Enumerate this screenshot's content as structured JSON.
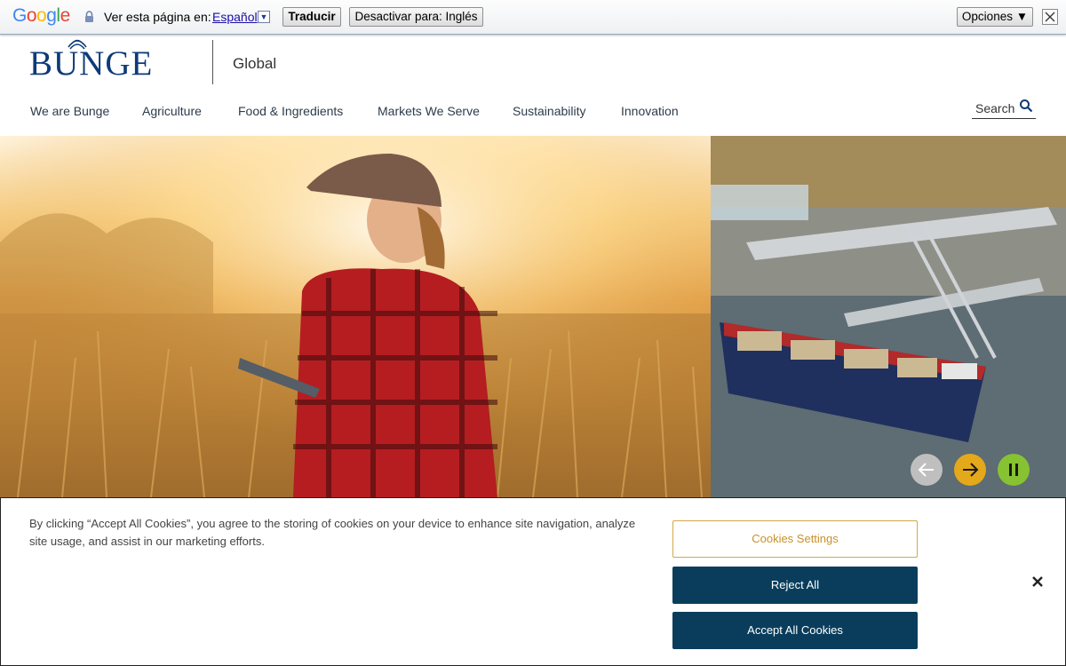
{
  "translate_bar": {
    "logo_letters": [
      {
        "char": "G",
        "color": "#4285f4"
      },
      {
        "char": "o",
        "color": "#ea4335"
      },
      {
        "char": "o",
        "color": "#fbbc05"
      },
      {
        "char": "g",
        "color": "#4285f4"
      },
      {
        "char": "l",
        "color": "#34a853"
      },
      {
        "char": "e",
        "color": "#ea4335"
      }
    ],
    "prompt": "Ver esta página en:",
    "language": "Español",
    "translate_button": "Traducir",
    "disable_button": "Desactivar para: Inglés",
    "options_button": "Opciones ▼"
  },
  "header": {
    "logo_text": "BUNGE",
    "region": "Global",
    "nav": [
      "We are Bunge",
      "Agriculture",
      "Food & Ingredients",
      "Markets We Serve",
      "Sustainability",
      "Innovation"
    ],
    "search_label": "Search"
  },
  "carousel": {
    "controls": [
      "previous",
      "next",
      "pause"
    ]
  },
  "cookie_banner": {
    "text": "By clicking “Accept All Cookies”, you agree to the storing of cookies on your device to enhance site navigation, analyze site usage, and assist in our marketing efforts.",
    "settings_button": "Cookies Settings",
    "reject_button": "Reject All",
    "accept_button": "Accept All Cookies"
  },
  "colors": {
    "brand_navy": "#0e3a78",
    "button_navy": "#0a3d5c",
    "accent_gold": "#c8912a",
    "next_yellow": "#e4a81b",
    "pause_green": "#87c232"
  }
}
